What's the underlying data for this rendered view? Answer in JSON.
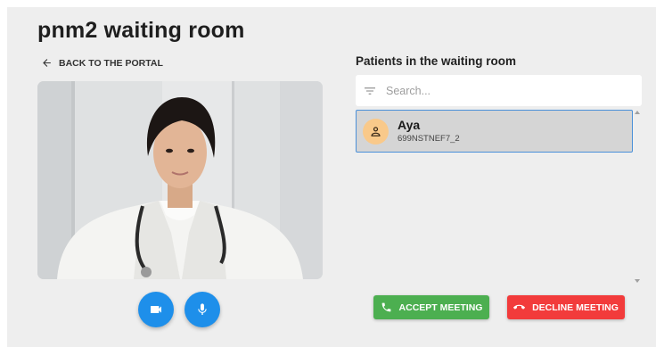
{
  "page": {
    "title": "pnm2 waiting room",
    "back_label": "BACK TO THE PORTAL"
  },
  "icons": {
    "back": "arrow-left-icon",
    "camera": "videocam-icon",
    "mic": "mic-icon",
    "filter": "filter-list-icon",
    "avatar": "person-icon",
    "accept": "phone-icon",
    "decline": "call-end-icon"
  },
  "waiting_room": {
    "heading": "Patients in the waiting room",
    "search_placeholder": "Search...",
    "patients": [
      {
        "name": "Aya",
        "id": "699NSTNEF7_2",
        "selected": true
      }
    ]
  },
  "actions": {
    "accept_label": "ACCEPT MEETING",
    "decline_label": "DECLINE MEETING"
  },
  "colors": {
    "primary": "#1e8fea",
    "accept": "#4caf50",
    "decline": "#f23b3b",
    "selected_border": "#4a90d9",
    "avatar_bg": "#f9c98a"
  }
}
